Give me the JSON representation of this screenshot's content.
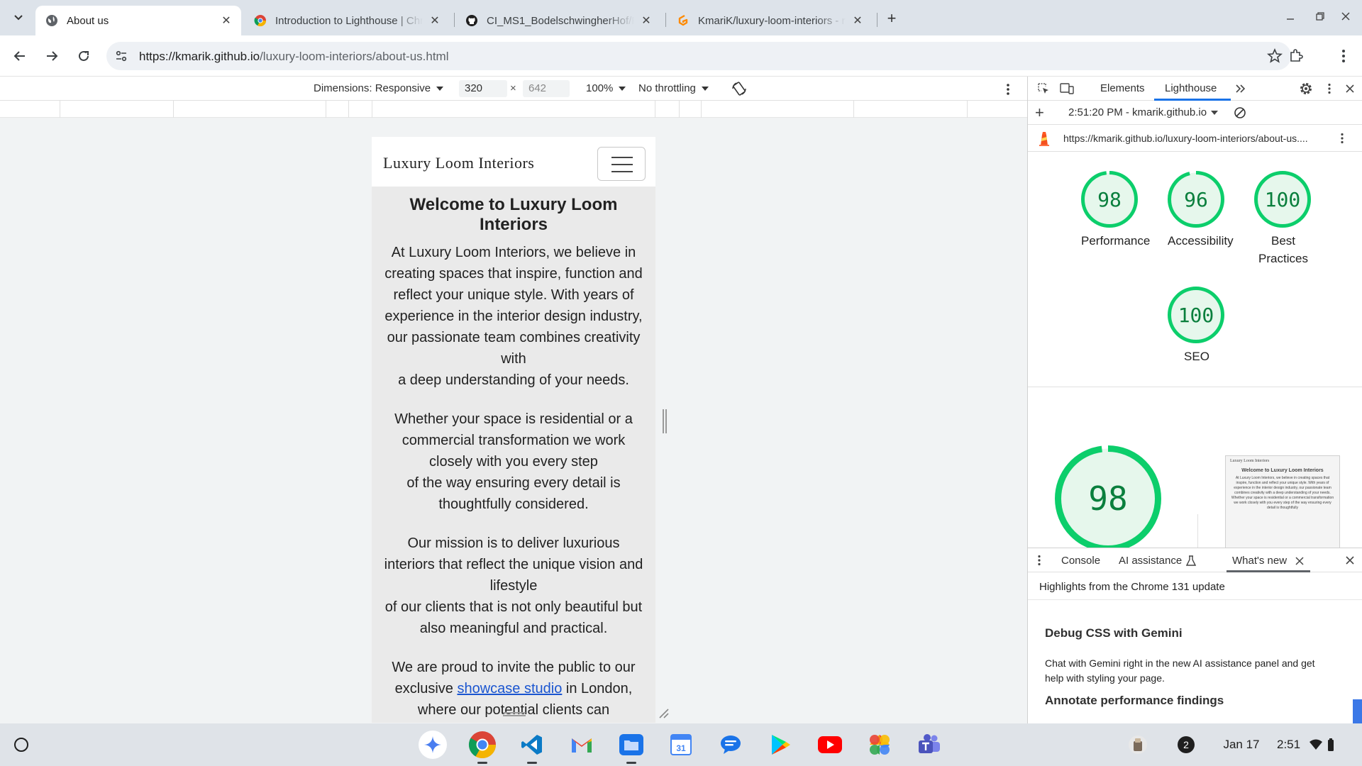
{
  "browser": {
    "tabs": [
      {
        "title": "About us",
        "favicon": "globe-icon"
      },
      {
        "title": "Introduction to Lighthouse  |  Chrome for Developers",
        "favicon": "chrome-icon"
      },
      {
        "title": "CI_MS1_BodelschwingherHof/README.md",
        "favicon": "github-icon"
      },
      {
        "title": "KmariK/luxury-loom-interiors - readme",
        "favicon": "gitpod-icon"
      }
    ],
    "url_host": "https://kmarik.github.io",
    "url_path": "/luxury-loom-interiors/about-us.html"
  },
  "device_toolbar": {
    "dimensions_label": "Dimensions: Responsive",
    "width": "320",
    "times": "×",
    "height": "642",
    "zoom": "100%",
    "throttling": "No throttling"
  },
  "page": {
    "brand": "Luxury Loom Interiors",
    "heading": "Welcome to Luxury Loom Interiors",
    "para1": "At Luxury Loom Interiors, we believe in creating spaces that inspire, function and reflect your unique style. With years of experience in the interior design industry, our passionate team combines creativity with\na deep understanding of your needs.",
    "para2": "Whether your space is residential or a commercial transformation we work closely with you every step\nof the way ensuring every detail is thoughtfully considered.",
    "para3": "Our mission is to deliver luxurious interiors that reflect the unique vision and lifestyle\nof our clients that is not only beautiful but also meaningful and practical.",
    "para4_before": "We are proud to invite the public to our exclusive ",
    "para4_link": "showcase studio",
    "para4_after": " in London, where our potential clients can"
  },
  "devtools": {
    "tabs": [
      "Elements",
      "Lighthouse"
    ],
    "report_time": "2:51:20 PM - kmarik.github.io",
    "report_url": "https://kmarik.github.io/luxury-loom-interiors/about-us....",
    "scores": [
      {
        "value": 98,
        "label": "Performance"
      },
      {
        "value": 96,
        "label": "Accessibility"
      },
      {
        "value": 100,
        "label": "Best Practices"
      },
      {
        "value": 100,
        "label": "SEO"
      }
    ],
    "big_score": 98,
    "thumb_title": "Welcome to Luxury Loom Interiors",
    "thumb_brand": "Luxury Loom Interiors",
    "thumb_text": "At Luxury Loom Interiors, we believe in creating spaces that inspire, function and reflect your unique style. With years of experience in the interior design industry, our passionate team combines creativity with a deep understanding of your needs. Whether your space is residential or a commercial transformation we work closely with you every step of the way ensuring every detail is thoughtfully"
  },
  "drawer": {
    "tabs": {
      "console": "Console",
      "ai": "AI assistance",
      "whats_new": "What's new"
    },
    "highlights": "Highlights from the Chrome 131 update",
    "h1": "Debug CSS with Gemini",
    "p1": "Chat with Gemini right in the new AI assistance panel and get help with styling your page.",
    "h2": "Annotate performance findings"
  },
  "shelf": {
    "notification_count": "2",
    "date": "Jan 17",
    "time": "2:51"
  },
  "colors": {
    "score_green": "#0cce6b",
    "score_text": "#0a7f3d",
    "tabstrip": "#dde3ea",
    "link": "#1a55d0"
  }
}
